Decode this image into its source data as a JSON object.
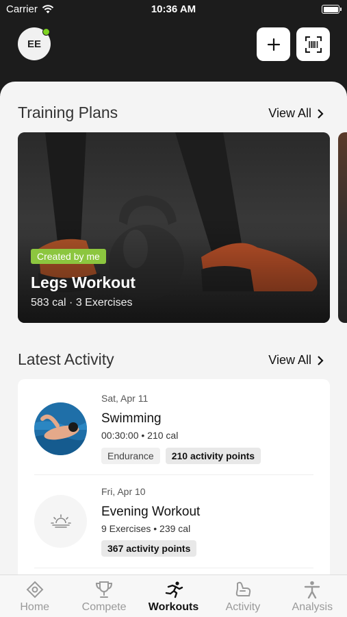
{
  "status_bar": {
    "carrier": "Carrier",
    "time": "10:36 AM"
  },
  "header": {
    "avatar_initials": "EE"
  },
  "training_plans": {
    "title": "Training Plans",
    "view_all": "View All",
    "card": {
      "badge": "Created by me",
      "title": "Legs Workout",
      "meta": "583 cal · 3 Exercises"
    }
  },
  "latest_activity": {
    "title": "Latest Activity",
    "view_all": "View All",
    "items": [
      {
        "date": "Sat, Apr 11",
        "name": "Swimming",
        "meta": "00:30:00 • 210 cal",
        "tags": [
          "Endurance",
          "210 activity points"
        ]
      },
      {
        "date": "Fri, Apr 10",
        "name": "Evening Workout",
        "meta": "9 Exercises • 239 cal",
        "tags": [
          "367 activity points"
        ]
      }
    ]
  },
  "tab_bar": {
    "tabs": [
      {
        "label": "Home",
        "icon": "home-icon"
      },
      {
        "label": "Compete",
        "icon": "trophy-icon"
      },
      {
        "label": "Workouts",
        "icon": "runner-icon",
        "active": true
      },
      {
        "label": "Activity",
        "icon": "activity-icon"
      },
      {
        "label": "Analysis",
        "icon": "person-icon"
      }
    ]
  },
  "colors": {
    "accent_green": "#8cc63f",
    "online": "#7ed321",
    "header_bg": "#1c1c1c"
  }
}
